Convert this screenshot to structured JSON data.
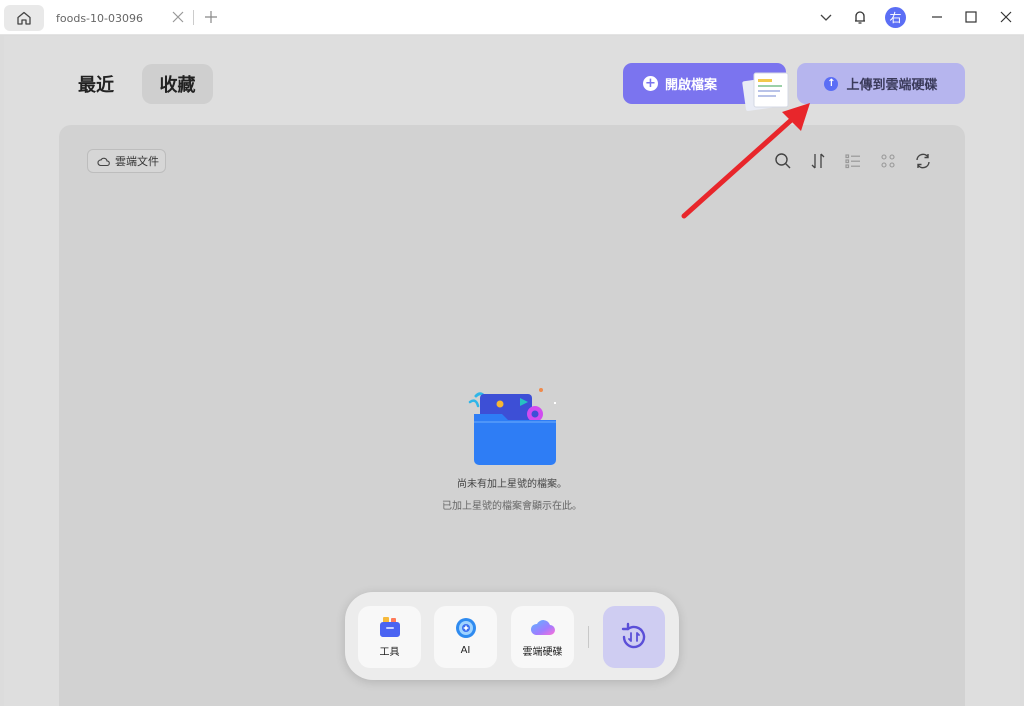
{
  "titlebar": {
    "home_icon": "home-icon",
    "doc_tab_label": "foods-10-03096",
    "avatar_text": "右"
  },
  "nav": {
    "recent_label": "最近",
    "favorites_label": "收藏"
  },
  "actions": {
    "open_file_label": "開啟檔案",
    "upload_cloud_label": "上傳到雲端硬碟"
  },
  "toolbar": {
    "cloud_docs_label": "雲端文件",
    "icons": [
      "search-icon",
      "sort-icon",
      "list-view-icon",
      "grid-view-icon",
      "refresh-icon"
    ]
  },
  "empty_state": {
    "title": "尚未有加上星號的檔案。",
    "subtitle": "已加上星號的檔案會顯示在此。"
  },
  "dock": {
    "tools_label": "工具",
    "ai_label": "AI",
    "cloud_label": "雲端硬碟"
  },
  "colors": {
    "accent": "#7b74ef",
    "upload_bg": "#b6b5ee",
    "annotation_arrow": "#e8262b"
  }
}
